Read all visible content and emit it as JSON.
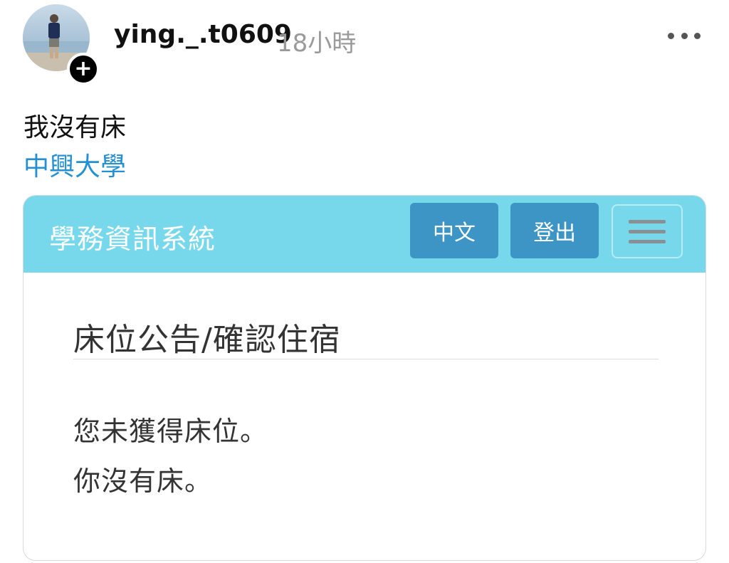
{
  "post": {
    "username": "ying._.t0609",
    "timestamp": "18小時",
    "caption": "我沒有床",
    "tag": "中興大學",
    "more_icon": "more-horizontal-icon",
    "follow_icon": "plus-icon"
  },
  "embedded": {
    "brand": "學務資訊系統",
    "nav_buttons": {
      "language": "中文",
      "logout": "登出"
    },
    "menu_icon": "hamburger-menu-icon",
    "heading": "床位公告/確認住宿",
    "messages": [
      "您未獲得床位。",
      "你沒有床。"
    ],
    "colors": {
      "navbar": "#77d8ec",
      "button": "#3d95c6",
      "link": "#2390d4"
    }
  }
}
